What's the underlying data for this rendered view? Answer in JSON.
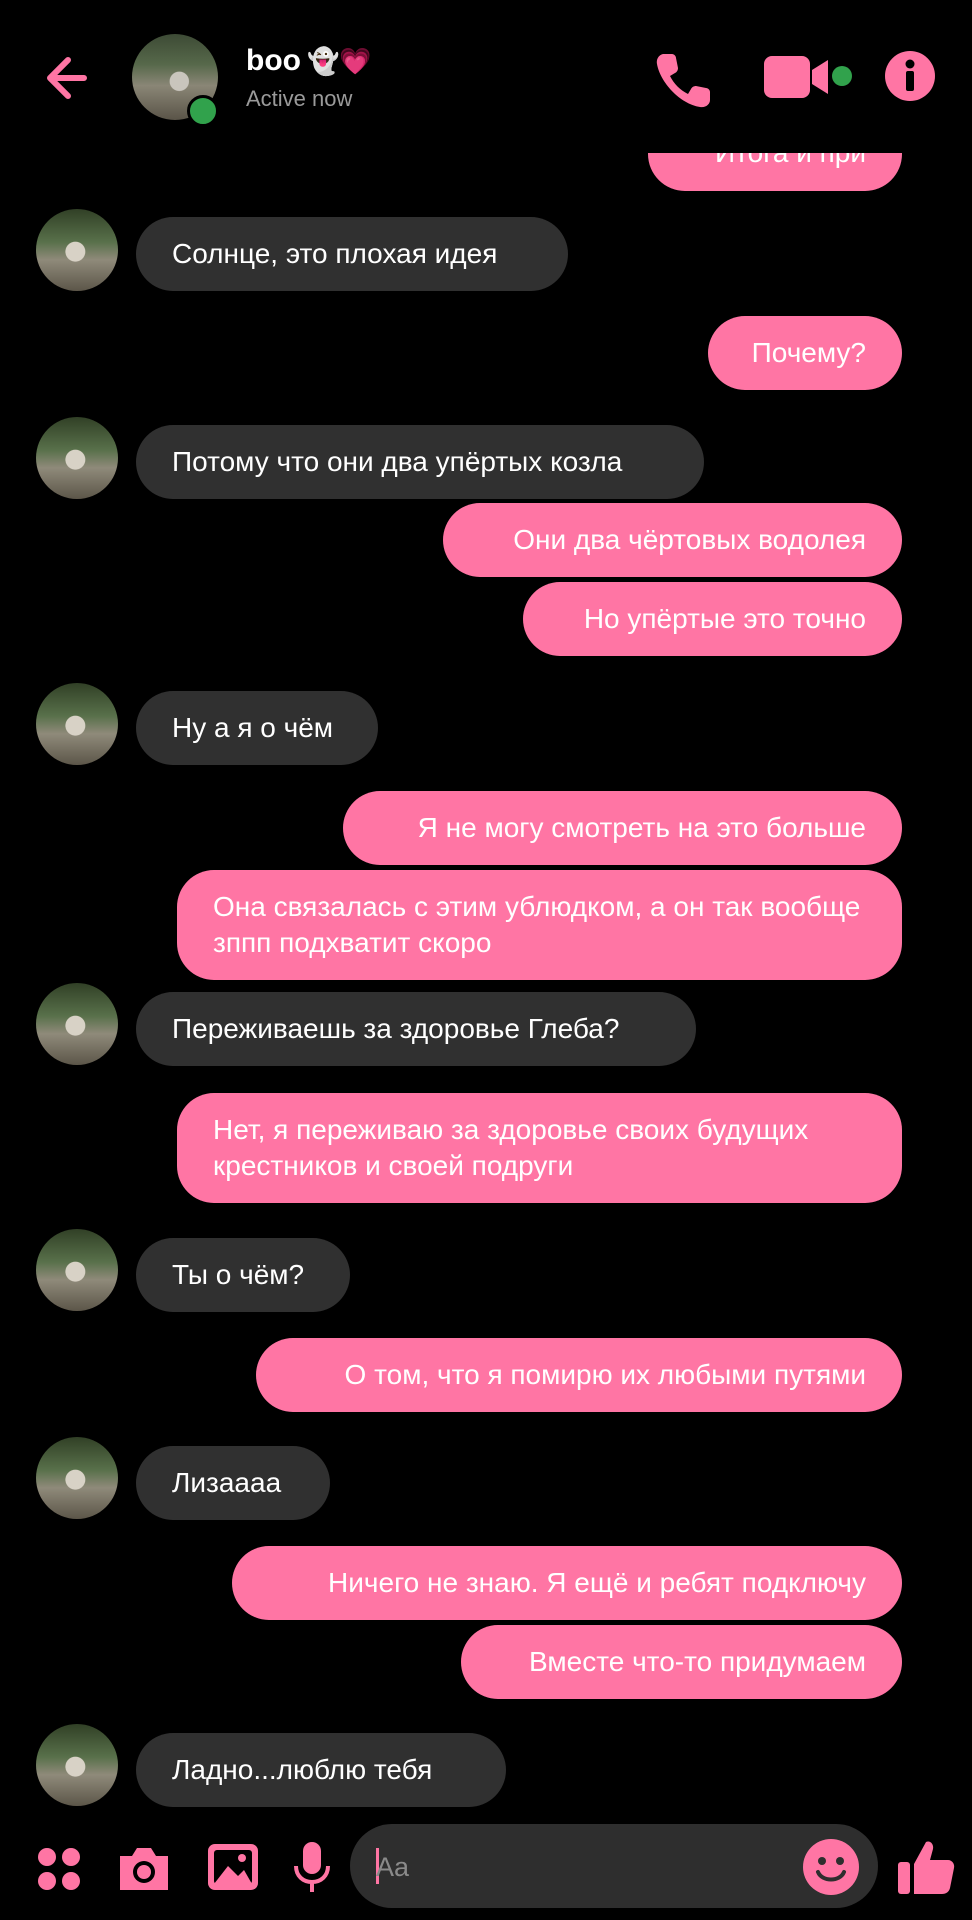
{
  "header": {
    "name": "boo",
    "name_emojis": "👻💗",
    "status": "Active now",
    "icons": [
      "back-arrow-icon",
      "phone-icon",
      "video-camera-icon",
      "info-icon"
    ]
  },
  "colors": {
    "accent": "#ff75a4",
    "incoming_bubble": "#303030",
    "online": "#31a24c",
    "background": "#000000"
  },
  "messages": [
    {
      "dir": "out",
      "text": "Итога и при"
    },
    {
      "dir": "in",
      "text": "Солнце,  это плохая идея"
    },
    {
      "dir": "out",
      "text": "Почему?"
    },
    {
      "dir": "in",
      "text": "Потому что они два упёртых козла"
    },
    {
      "dir": "out",
      "text": "Они два чёртовых водолея"
    },
    {
      "dir": "out",
      "text": "Но упёртые это точно"
    },
    {
      "dir": "in",
      "text": "Ну а я о чём"
    },
    {
      "dir": "out",
      "text": "Я не могу смотреть на это больше"
    },
    {
      "dir": "out",
      "text": "Она связалась с этим ублюдком,  а он так вообще зппп подхватит скоро"
    },
    {
      "dir": "in",
      "text": "Переживаешь за здоровье Глеба?"
    },
    {
      "dir": "out",
      "text": "Нет, я переживаю за здоровье своих будущих крестников и своей подруги"
    },
    {
      "dir": "in",
      "text": "Ты о чём?"
    },
    {
      "dir": "out",
      "text": "О том, что я помирю их любыми путями"
    },
    {
      "dir": "in",
      "text": "Лизаааа"
    },
    {
      "dir": "out",
      "text": "Ничего не знаю. Я ещё и ребят подключу"
    },
    {
      "dir": "out",
      "text": "Вместе что-то придумаем"
    },
    {
      "dir": "in",
      "text": "Ладно...люблю тебя"
    }
  ],
  "composer": {
    "placeholder": "Aa",
    "icons": [
      "apps-menu-icon",
      "camera-icon",
      "gallery-icon",
      "microphone-icon",
      "emoji-icon",
      "thumbs-up-icon"
    ]
  }
}
